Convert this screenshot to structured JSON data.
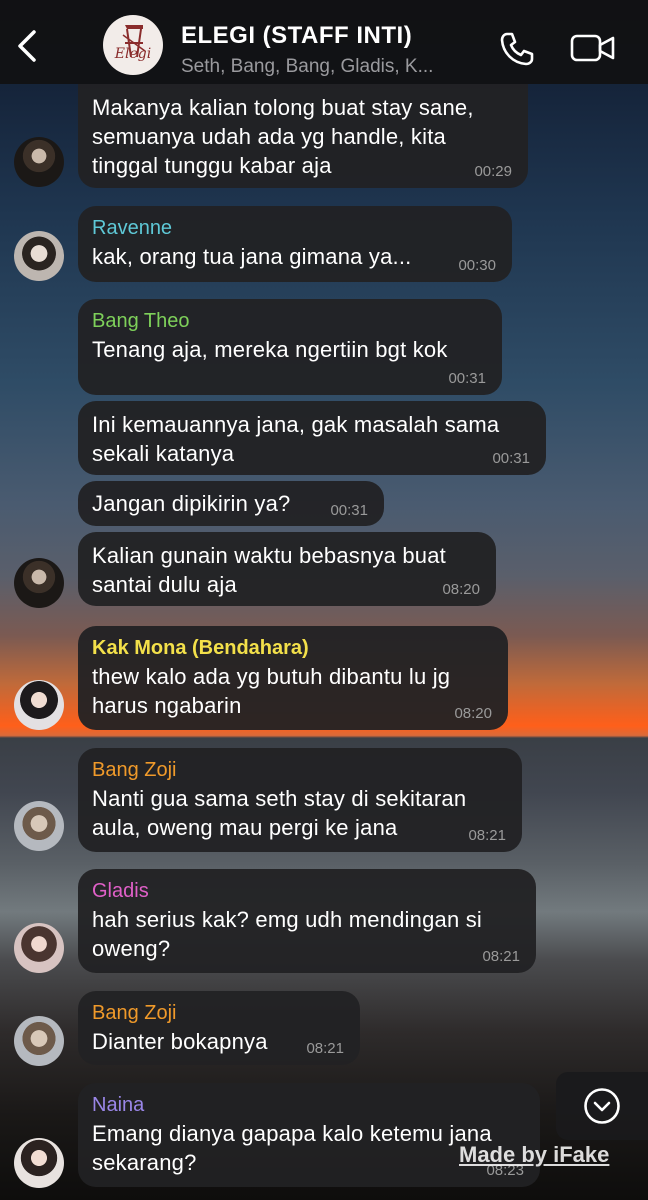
{
  "header": {
    "title": "ELEGI (STAFF INTI)",
    "subtitle": "Seth, Bang, Bang, Gladis, K...",
    "logo_text": "Elegi",
    "back_icon": "chevron-left-icon",
    "call_icon": "phone-icon",
    "video_icon": "video-camera-icon"
  },
  "colors": {
    "ravenne": "#5ec8d6",
    "theo": "#7ed05a",
    "mona": "#f3e04a",
    "zoji": "#f09a2a",
    "gladis": "#e060c8",
    "naina": "#9a86e8"
  },
  "messages": [
    {
      "name": "",
      "text": "Makanya kalian tolong buat stay sane, semuanya udah ada yg handle, kita tinggal tunggu kabar aja",
      "time": "00:29"
    },
    {
      "name": "Ravenne",
      "text": "kak, orang tua jana gimana ya...",
      "time": "00:30"
    },
    {
      "name": "Bang Theo",
      "text": "Tenang aja, mereka ngertiin bgt kok",
      "time": "00:31"
    },
    {
      "name": "",
      "text": "Ini kemauannya jana, gak masalah sama sekali katanya",
      "time": "00:31"
    },
    {
      "name": "",
      "text": "Jangan dipikirin ya?",
      "time": "00:31"
    },
    {
      "name": "",
      "text": "Kalian gunain waktu bebasnya buat santai dulu aja",
      "time": "08:20"
    },
    {
      "name": "Kak Mona (Bendahara)",
      "text": "thew kalo ada yg butuh dibantu lu jg harus ngabarin",
      "time": "08:20"
    },
    {
      "name": "Bang Zoji",
      "text": "Nanti gua sama seth stay di sekitaran aula, oweng mau pergi ke jana",
      "time": "08:21"
    },
    {
      "name": "Gladis",
      "text": "hah serius kak? emg udh mendingan si oweng?",
      "time": "08:21"
    },
    {
      "name": "Bang Zoji",
      "text": "Dianter bokapnya",
      "time": "08:21"
    },
    {
      "name": "Naina",
      "text": "Emang dianya gapapa kalo ketemu jana sekarang?",
      "time": "08:23"
    }
  ],
  "scroll_icon": "chevron-down-circle-icon",
  "watermark": "Made by iFake"
}
